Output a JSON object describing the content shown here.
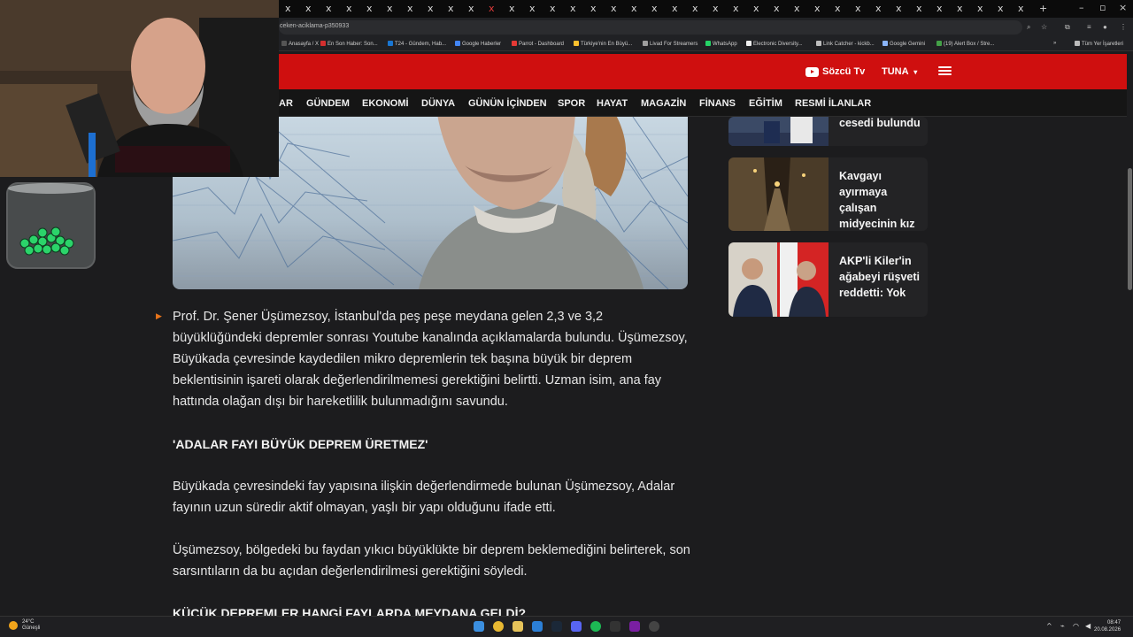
{
  "browser": {
    "url": "ceken-aciklama-p350933",
    "tab_close_glyph": "x",
    "new_tab_glyph": "+",
    "window_controls": [
      "–",
      "▫",
      "×"
    ],
    "bookmarks": [
      {
        "label": "Anasayfa / X",
        "color": "#555555"
      },
      {
        "label": "En Son Haber: Son...",
        "color": "#d32f2f"
      },
      {
        "label": "T24 - Gündem, Hab...",
        "color": "#1976d2"
      },
      {
        "label": "Google Haberler",
        "color": "#4285f4"
      },
      {
        "label": "Parrot - Dashboard",
        "color": "#e53935"
      },
      {
        "label": "Türkiye'nin En Büyü...",
        "color": "#fbc02d"
      },
      {
        "label": "Livad For Streamers",
        "color": "#9e9e9e"
      },
      {
        "label": "WhatsApp",
        "color": "#25d366"
      },
      {
        "label": "Electronic Diversity...",
        "color": "#eeeeee"
      },
      {
        "label": "Link Catcher - kickb...",
        "color": "#bdbdbd"
      },
      {
        "label": "Google Gemini",
        "color": "#8ab4f8"
      },
      {
        "label": "(19) Alert Box / Stre...",
        "color": "#43a047"
      }
    ],
    "bookmarks_more": "»",
    "all_bookmarks": "Tüm Yer İşaretleri"
  },
  "site": {
    "brand_color": "#cf0f0f",
    "tv_label": "Sözcü Tv",
    "user_label": "TUNA",
    "user_caret": "▾",
    "nav": [
      "AR",
      "GÜNDEM",
      "EKONOMİ",
      "DÜNYA",
      "GÜNÜN İÇİNDEN",
      "SPOR",
      "HAYAT",
      "MAGAZİN",
      "FİNANS",
      "EĞİTİM",
      "RESMİ İLANLAR"
    ]
  },
  "article": {
    "bullet": "▶",
    "paragraphs": [
      "Prof. Dr. Şener Üşümezsoy, İstanbul'da peş peşe meydana gelen 2,3 ve 3,2 büyüklüğündeki depremler sonrası Youtube kanalında açıklamalarda bulundu. Üşümezsoy, Büyükada çevresinde kaydedilen mikro depremlerin tek başına büyük bir deprem beklentisinin işareti olarak değerlendirilmemesi gerektiğini belirtti. Uzman isim, ana fay hattında olağan dışı bir hareketlilik bulunmadığını savundu.",
      "Büyükada çevresindeki fay yapısına ilişkin değerlendirmede bulunan Üşümezsoy, Adalar fayının uzun süredir aktif olmayan, yaşlı bir yapı olduğunu ifade etti.",
      "Üşümezsoy, bölgedeki bu faydan yıkıcı büyüklükte bir deprem beklemediğini belirterek, son sarsıntıların da bu açıdan değerlendirilmesi gerektiğini söyledi."
    ],
    "subheads": [
      "'ADALAR FAYI BÜYÜK DEPREM ÜRETMEZ'",
      "KÜÇÜK DEPREMLER HANGİ FAYLARDA MEYDANA GELDİ?"
    ]
  },
  "sidebar": {
    "cards": [
      {
        "title": "cesedi bulundu"
      },
      {
        "title": "Kavgayı ayırmaya çalışan midyecinin kız kardeşini..."
      },
      {
        "title": "AKP'li Kiler'in ağabeyi rüşveti reddetti: Yok"
      }
    ]
  },
  "taskbar": {
    "weather_temp": "24°C",
    "weather_desc": "Güneşli",
    "time": "08:47",
    "date": "20.08.2026",
    "tray_chevron": "^"
  }
}
